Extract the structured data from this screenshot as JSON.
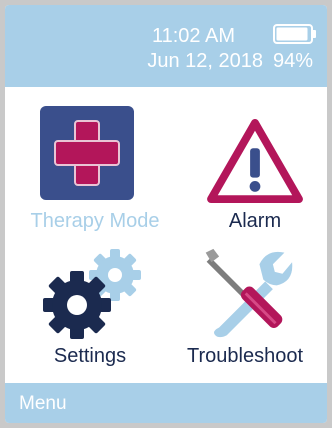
{
  "status": {
    "time": "11:02 AM",
    "date": "Jun 12, 2018",
    "battery_percent": "94%",
    "battery_level": 0.94
  },
  "tiles": [
    {
      "label": "Therapy Mode",
      "icon": "medical-cross-icon"
    },
    {
      "label": "Alarm",
      "icon": "warning-triangle-icon"
    },
    {
      "label": "Settings",
      "icon": "gears-icon"
    },
    {
      "label": "Troubleshoot",
      "icon": "screwdriver-wrench-icon"
    }
  ],
  "menu": {
    "label": "Menu"
  },
  "colors": {
    "accent_light_blue": "#a8cfe8",
    "navy": "#3a4f8c",
    "magenta": "#b3165a"
  }
}
